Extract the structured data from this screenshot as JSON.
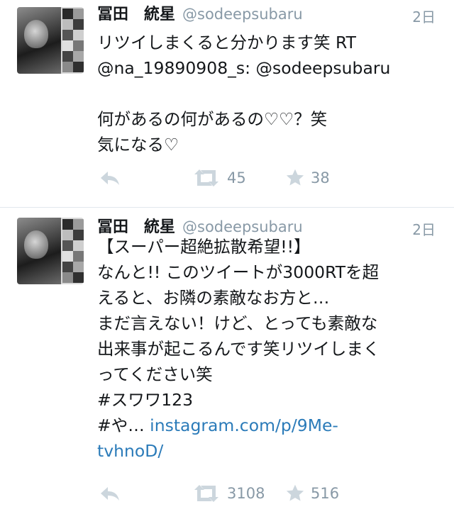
{
  "tweets": [
    {
      "author": {
        "name": "冨田　統星",
        "handle": "@sodeepsubaru"
      },
      "time": "2日",
      "lines": [
        "リツイしまくると分かります笑 RT",
        "@na_19890908_s: @sodeepsubaru",
        "",
        "何があるの何があるの♡♡？笑",
        "気になる♡"
      ],
      "retweets": "45",
      "favorites": "38"
    },
    {
      "author": {
        "name": "冨田　統星",
        "handle": "@sodeepsubaru"
      },
      "time": "2日",
      "lines": [
        "【スーパー超絶拡散希望!!】",
        "なんと!! このツイートが3000RTを超",
        "えると、お隣の素敵なお方と…",
        "まだ言えない！けど、とっても素敵な",
        "出来事が起こるんです笑リツイしまく",
        "ってください笑",
        "#スワワ123"
      ],
      "link_prefix": "#や… ",
      "link_part1": "instagram.com/p/9Me-",
      "link_part2": "tvhnoD/",
      "retweets": "3108",
      "favorites": "516"
    }
  ],
  "icons": [
    "reply-icon",
    "retweet-icon",
    "favorite-star-icon"
  ],
  "colors": {
    "muted": "#8899a6",
    "link": "#2b7bb9",
    "text": "#14171a",
    "divider": "#e1e8ed"
  }
}
